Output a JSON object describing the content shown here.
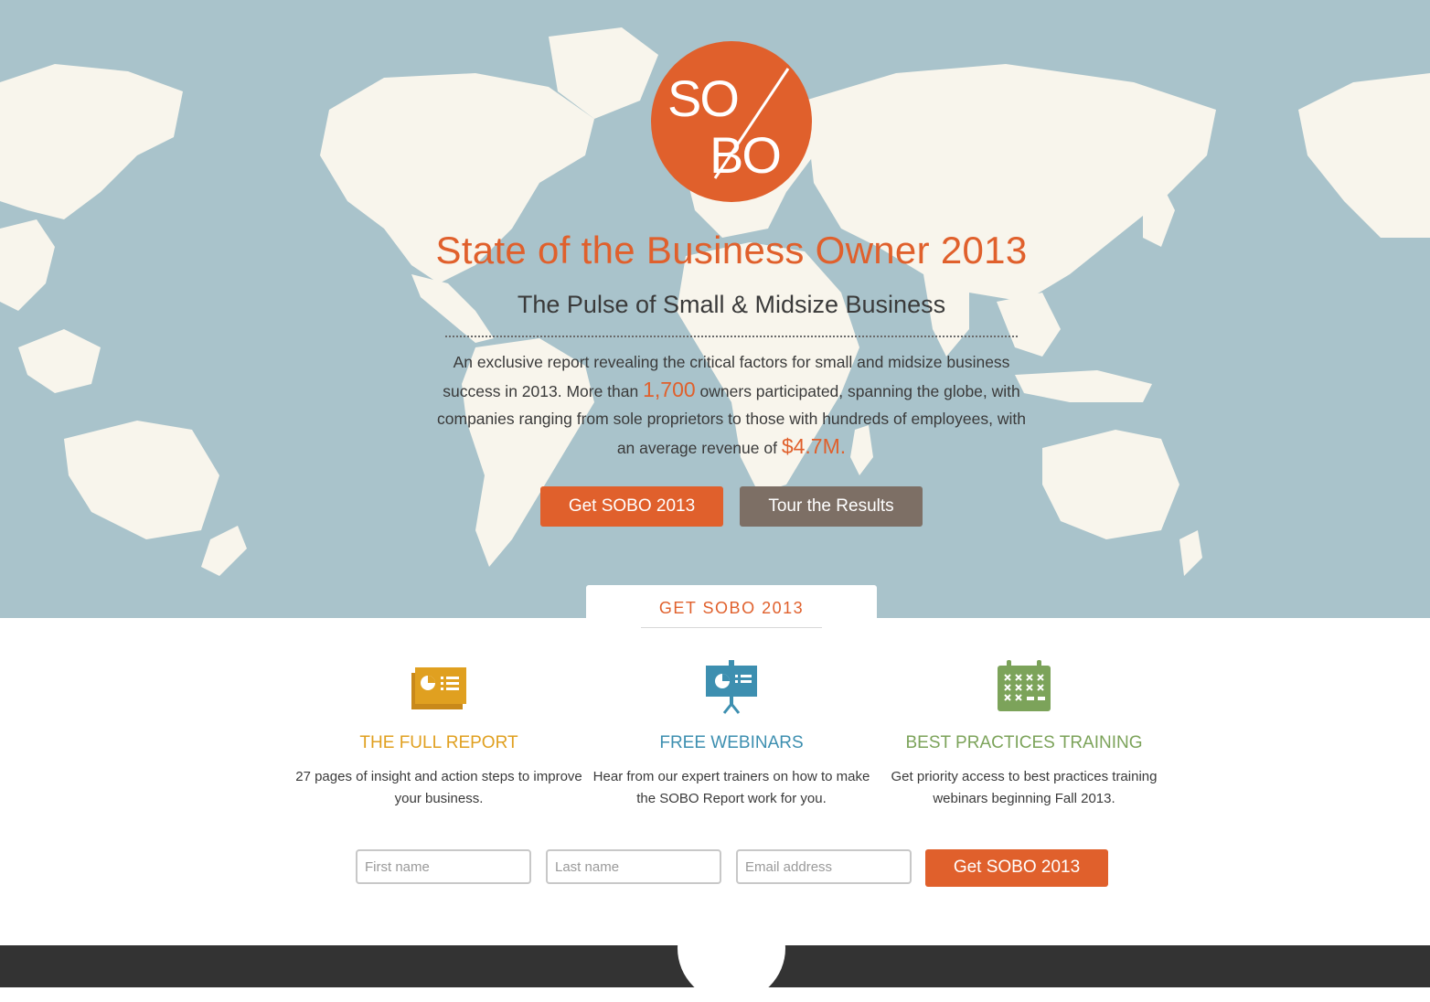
{
  "colors": {
    "accent": "#e0602c",
    "ocean": "#a9c3cb",
    "land": "#f8f5ec",
    "tour_button": "#7d6f65",
    "report": "#e0a020",
    "webinars": "#3d8fb0",
    "training": "#7ca35a",
    "footer": "#333333"
  },
  "logo": {
    "top": "SO",
    "bottom": "BO"
  },
  "hero": {
    "title": "State of the Business Owner 2013",
    "subtitle": "The Pulse of Small & Midsize Business",
    "intro_part1": "An exclusive report revealing the critical factors for small and midsize business success in 2013. More than ",
    "participants": "1,700",
    "intro_part2": " owners participated, spanning the globe, with companies ranging from sole proprietors to those with hundreds of employees, with an average revenue of ",
    "revenue": "$4.7M.",
    "get_button": "Get SOBO 2013",
    "tour_button": "Tour the Results"
  },
  "tab": {
    "label": "GET SOBO 2013"
  },
  "features": [
    {
      "icon": "report-icon",
      "title": "THE FULL REPORT",
      "text": "27 pages of insight and action steps to improve your business."
    },
    {
      "icon": "presentation-icon",
      "title": "FREE WEBINARS",
      "text": "Hear from our expert trainers on how to make the SOBO Report work for you."
    },
    {
      "icon": "calendar-icon",
      "title": "BEST PRACTICES TRAINING",
      "text": "Get priority access to best practices training webinars beginning Fall 2013."
    }
  ],
  "form": {
    "first_name_placeholder": "First name",
    "last_name_placeholder": "Last name",
    "email_placeholder": "Email address",
    "submit": "Get SOBO 2013"
  }
}
